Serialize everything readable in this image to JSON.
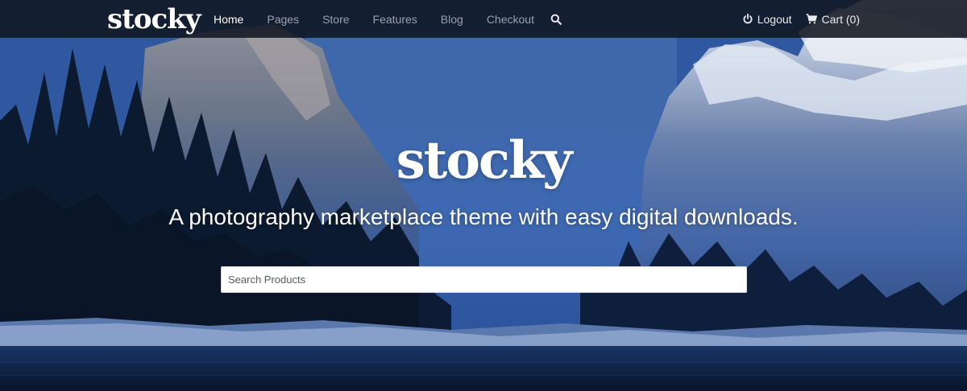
{
  "navbar": {
    "brand": "stocky",
    "links": [
      {
        "label": "Home",
        "active": true
      },
      {
        "label": "Pages",
        "active": false
      },
      {
        "label": "Store",
        "active": false
      },
      {
        "label": "Features",
        "active": false
      },
      {
        "label": "Blog",
        "active": false
      },
      {
        "label": "Checkout",
        "active": false
      }
    ],
    "search_icon": "search-icon",
    "logout": {
      "label": "Logout",
      "icon": "power-icon"
    },
    "cart": {
      "label": "Cart (0)",
      "icon": "cart-icon"
    }
  },
  "hero": {
    "logo": "stocky",
    "tagline": "A photography marketplace theme with easy digital downloads.",
    "search": {
      "placeholder": "Search Products",
      "value": ""
    }
  },
  "colors": {
    "navbar_bg": "#111621",
    "nav_text": "#9aa1ab",
    "nav_active": "#ffffff",
    "hero_text": "#ffffff"
  }
}
